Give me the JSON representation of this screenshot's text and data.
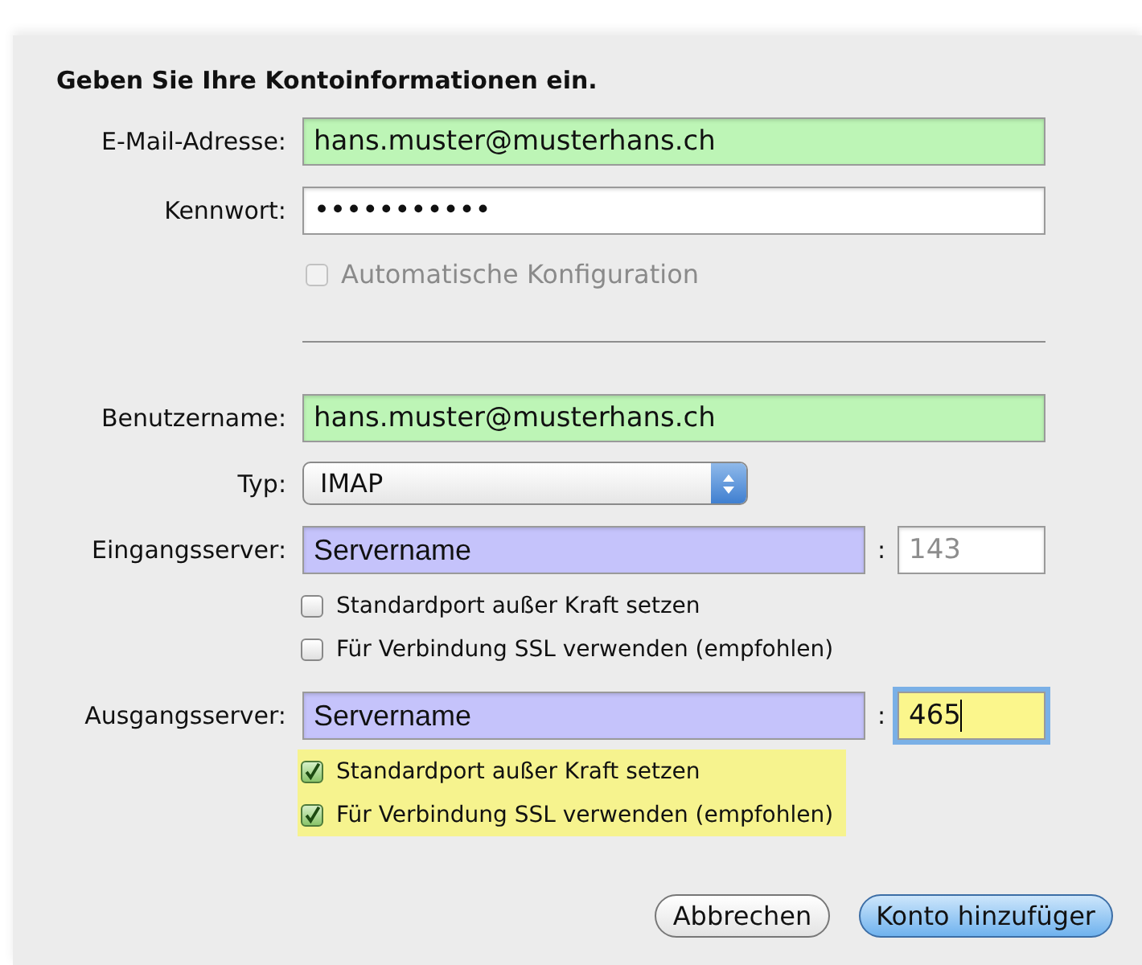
{
  "title": "Geben Sie Ihre Kontoinformationen ein.",
  "rows": [
    {
      "kind": "field",
      "label": "E-Mail-Adresse:",
      "value": "hans.muster@musterhans.ch",
      "color": "#bdf5b6"
    },
    {
      "kind": "field",
      "label": "Kennwort:",
      "value": "•••••••••••"
    },
    {
      "kind": "checkbox",
      "label": "Automatische Konfiguration",
      "checked": false,
      "disabled": true
    },
    {
      "kind": "divider"
    },
    {
      "kind": "field",
      "label": "Benutzername:",
      "value": "hans.muster@musterhans.ch",
      "color": "#bdf5b6"
    },
    {
      "kind": "select",
      "label": "Typ:",
      "value": "IMAP"
    },
    {
      "kind": "server",
      "label": "Eingangsserver:",
      "value": "Servername",
      "color": "#c5c3fb",
      "separator": ":",
      "port": {
        "placeholder": "143",
        "focused": false
      },
      "options": [
        {
          "label": "Standardport außer Kraft setzen",
          "checked": false
        },
        {
          "label": "Für Verbindung SSL verwenden (empfohlen)",
          "checked": false
        }
      ]
    },
    {
      "kind": "server",
      "label": "Ausgangsserver:",
      "value": "Servername",
      "color": "#c5c3fb",
      "separator": ":",
      "port": {
        "value": "465",
        "color": "#fbf68c",
        "focused": true
      },
      "options": [
        {
          "label": "Standardport außer Kraft setzen",
          "checked": true,
          "color": "#f6f38e"
        },
        {
          "label": "Für Verbindung SSL verwenden (empfohlen)",
          "checked": true,
          "color": "#f6f38e"
        }
      ]
    }
  ],
  "buttons": [
    {
      "label": "Abbrechen",
      "default": false
    },
    {
      "label": "Konto hinzufüger",
      "default": true
    }
  ]
}
